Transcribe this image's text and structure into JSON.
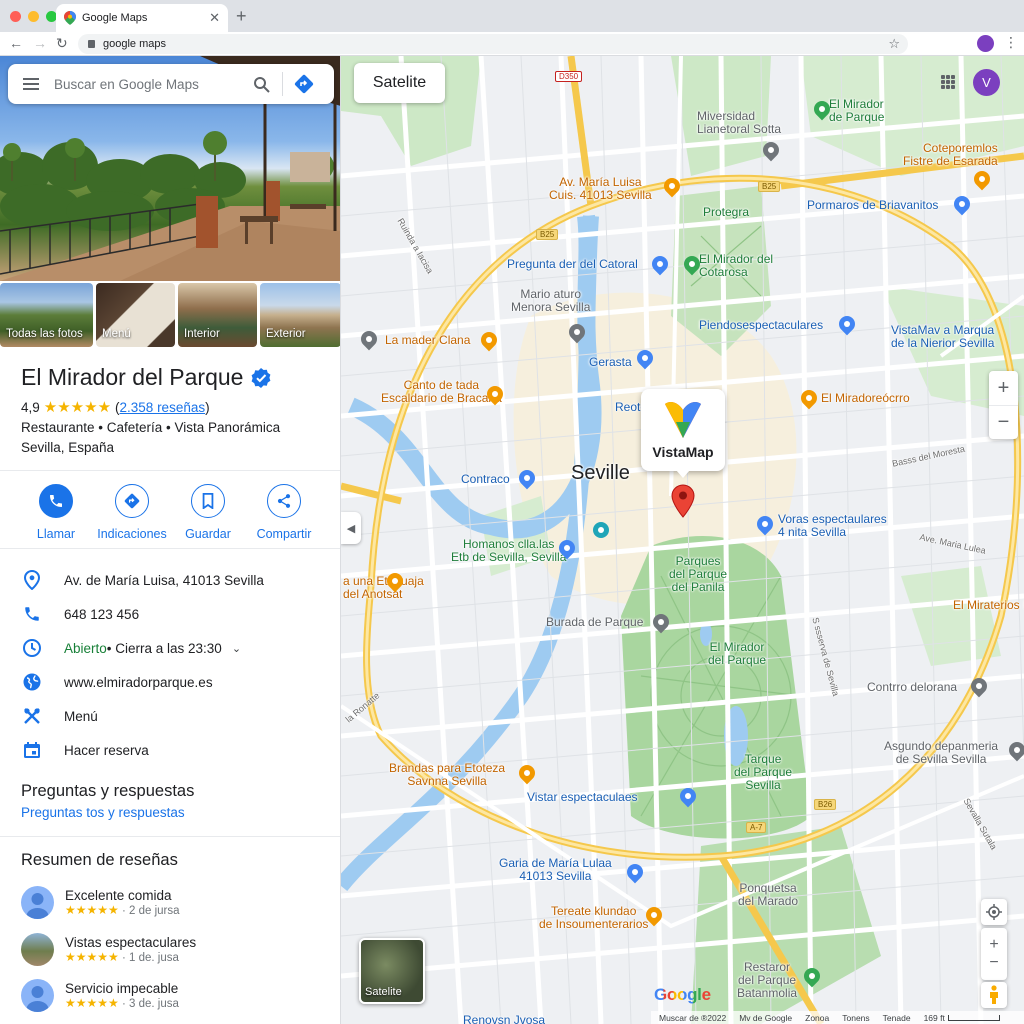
{
  "browser": {
    "tab_title": "Google Maps",
    "address": "google maps"
  },
  "panel": {
    "search_placeholder": "Buscar en Google Maps",
    "photos": [
      {
        "label": "Todas las fotos"
      },
      {
        "label": "Menú"
      },
      {
        "label": "Interior"
      },
      {
        "label": "Exterior"
      }
    ],
    "place": {
      "name": "El Mirador del Parque",
      "rating": "4,9",
      "stars": "★★★★★",
      "reviews_open": "(",
      "reviews_link": "2.358 reseñas",
      "reviews_close": ")",
      "categories": "Restaurante • Cafetería • Vista Panorámica",
      "location": "Sevilla, España"
    },
    "actions": [
      {
        "label": "Llamar"
      },
      {
        "label": "Indicaciones"
      },
      {
        "label": "Guardar"
      },
      {
        "label": "Compartir"
      }
    ],
    "info": {
      "address": "Av. de María Luisa, 41013 Sevilla",
      "phone": "648 123 456",
      "open_status": "Abierto",
      "hours": " • Cierra a las 23:30",
      "website": "www.elmiradorparque.es",
      "menu": "Menú",
      "reserve": "Hacer reserva"
    },
    "qa": {
      "title": "Preguntas y respuestas",
      "link": "Preguntas tos y respuestas"
    },
    "reviews_summary": {
      "title": "Resumen de reseñas",
      "items": [
        {
          "title": "Excelente comida",
          "stars": "★★★★★",
          "date": " · 2 de jursa"
        },
        {
          "title": "Vistas espectaculares",
          "stars": "★★★★★",
          "date": " · 1 de. jusa"
        },
        {
          "title": "Servicio impecable",
          "stars": "★★★★★",
          "date": " · 3 de. jusa"
        }
      ]
    }
  },
  "map": {
    "satellite_button": "Satelite",
    "user_initial": "V",
    "city": "Seville",
    "popup_brand": "VistaMap",
    "satellite_thumb": "Satelite",
    "google_logo": "Google",
    "footer": {
      "data": "Muscar de ®2022",
      "maps": "Mv de Google",
      "zone": "Zonoa",
      "terms": "Tonens",
      "send": "Tenade",
      "scale": "169 ft"
    },
    "shields": [
      "D350",
      "B25",
      "B25",
      "B26",
      "A-7"
    ],
    "labels": {
      "miversidad": "Miversidad\nLianetoral Sotta",
      "mirador_top": "El Mirador\nde Parque",
      "coteporemlos": "Coteporemlos\nFistre de Esarada",
      "maria_luisa": "Av. María Luisa\nCuis. 41013 Sevilla",
      "pormaros": "Pormaros de Briavanitos",
      "protegra": "Protegra",
      "ruinda": "Ruinda a Iacisa",
      "pregunta": "Pregunta der del Catoral",
      "mirador_cotarosa": "El Mirador del\nCotarosa",
      "mario": "Mario aturo\nMenora Sevilla",
      "piendos": "Piendosespectaculares",
      "vistamay": "VistaMav a Marqua\nde la Nierior Sevilla",
      "madercl": "La mader Clana",
      "gerasta": "Gerasta",
      "canto": "Canto de tada\nEscaldario de Bracana",
      "reote": "Reote",
      "miradoreo": "El Miradoreócrro",
      "bass": "Basss del Moresta",
      "contraco": "Contraco",
      "voras": "Voras espectaulares\n4 nita Sevilla",
      "avmaria": "Ave. Maria Lulea",
      "homanos": "Homanos clla.las\nEtb de Sevilla, Sevilla",
      "parques": "Parques\ndel Parque\ndel Panila",
      "etonuaja": "a una Etonuaja\ndel Anotsat",
      "mirater": "El Miraterios P",
      "burada": "Burada de Parque",
      "mirador_parque": "El Mirador\ndel Parque",
      "sserva": "S ssserva de Sevilla",
      "contrro": "Contrro delorana",
      "ronatte": "la Ronatte",
      "asgundo": "Asgundo depanmeria\nde Sevilla Sevilla",
      "tarque": "Tarque\ndel Parque\nSevilla",
      "brandas": "Brandas para Etoteza\nSavnna Sevilla",
      "vistar": "Vistar espectaculaes",
      "sevalla": "Sevalla Sutala",
      "garia": "Garia de María Lulaa\n41013 Sevilla",
      "ponquetsa": "Ponquetsa\ndel Marado",
      "tereate": "Tereate klundao\nde Insoumenterarios",
      "restaror": "Restaror\ndel Parque\nBatanmolia",
      "renovsn": "Renovsn Jvosa"
    }
  }
}
